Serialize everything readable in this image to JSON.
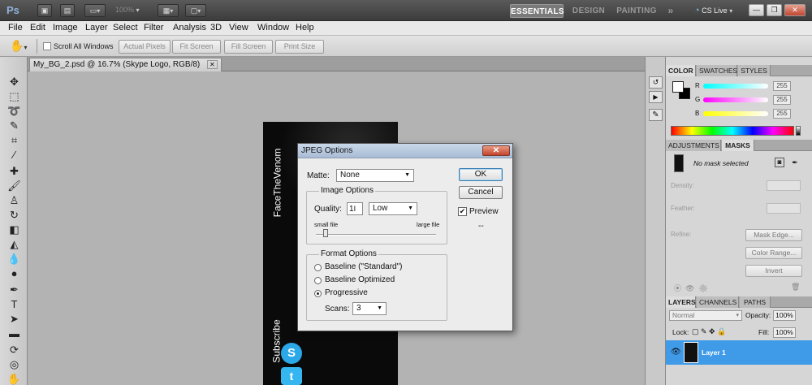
{
  "app": {
    "logo": "Ps",
    "zoom": "100%",
    "workspaces": [
      "ESSENTIALS",
      "DESIGN",
      "PAINTING"
    ],
    "more_icon": "»",
    "cs_live": "CS Live",
    "window_buttons": {
      "minimize": "—",
      "restore": "❐",
      "close": "✕"
    }
  },
  "menu": [
    "File",
    "Edit",
    "Image",
    "Layer",
    "Select",
    "Filter",
    "Analysis",
    "3D",
    "View",
    "Window",
    "Help"
  ],
  "options": {
    "scroll_all_windows": "Scroll All Windows",
    "buttons": [
      "Actual Pixels",
      "Fit Screen",
      "Fill Screen",
      "Print Size"
    ]
  },
  "document": {
    "tab_title": "My_BG_2.psd @ 16.7% (Skype Logo, RGB/8)",
    "tab_close": "✕",
    "canvas_text_top": "FaceTheVenom",
    "canvas_text_bottom": "Subscribe"
  },
  "color_panel": {
    "tabs": [
      "COLOR",
      "SWATCHES",
      "STYLES"
    ],
    "channels": [
      {
        "label": "R",
        "value": "255",
        "color": "#ff2a2a"
      },
      {
        "label": "G",
        "value": "255",
        "color": "#2aff2a"
      },
      {
        "label": "B",
        "value": "255",
        "color": "#2a5aff"
      }
    ]
  },
  "masks_panel": {
    "tabs": [
      "ADJUSTMENTS",
      "MASKS"
    ],
    "status": "No mask selected",
    "density_label": "Density:",
    "feather_label": "Feather:",
    "refine_label": "Refine:",
    "buttons": [
      "Mask Edge...",
      "Color Range...",
      "Invert"
    ]
  },
  "layers_panel": {
    "tabs": [
      "LAYERS",
      "CHANNELS",
      "PATHS"
    ],
    "blend_mode": "Normal",
    "opacity_label": "Opacity:",
    "opacity_value": "100%",
    "lock_label": "Lock:",
    "fill_label": "Fill:",
    "fill_value": "100%",
    "layer_name": "Layer 1"
  },
  "dialog": {
    "title": "JPEG Options",
    "close": "✕",
    "matte_label": "Matte:",
    "matte_value": "None",
    "image_options_legend": "Image Options",
    "quality_label": "Quality:",
    "quality_value": "1",
    "quality_preset": "Low",
    "small_file": "small file",
    "large_file": "large file",
    "quality_fraction": 0.08,
    "format_options_legend": "Format Options",
    "formats": [
      "Baseline (\"Standard\")",
      "Baseline Optimized",
      "Progressive"
    ],
    "selected_format": "Progressive",
    "scans_label": "Scans:",
    "scans_value": "3",
    "ok": "OK",
    "cancel": "Cancel",
    "preview": "Preview",
    "preview_checked": true,
    "size_placeholder": "--"
  }
}
